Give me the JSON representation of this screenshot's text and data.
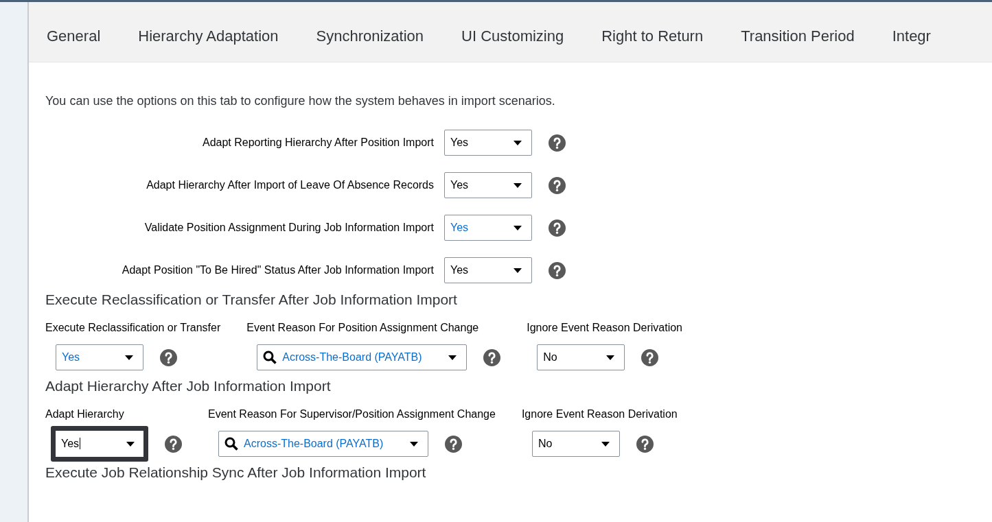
{
  "tabs": [
    {
      "label": "General",
      "selected": false
    },
    {
      "label": "Hierarchy Adaptation",
      "selected": false
    },
    {
      "label": "Synchronization",
      "selected": false
    },
    {
      "label": "UI Customizing",
      "selected": false
    },
    {
      "label": "Right to Return",
      "selected": false
    },
    {
      "label": "Transition Period",
      "selected": false
    },
    {
      "label": "Integr",
      "selected": false
    }
  ],
  "intro": "You can use the options on this tab to configure how the system behaves in import scenarios.",
  "settings": [
    {
      "label": "Adapt Reporting Hierarchy After Position Import",
      "value": "Yes",
      "highlighted": false
    },
    {
      "label": "Adapt Hierarchy After Import of Leave Of Absence Records",
      "value": "Yes",
      "highlighted": false
    },
    {
      "label": "Validate Position Assignment During Job Information Import",
      "value": "Yes",
      "highlighted": true
    },
    {
      "label": "Adapt Position \"To Be Hired\" Status After Job Information Import",
      "value": "Yes",
      "highlighted": false
    }
  ],
  "sections": [
    {
      "title": "Execute Reclassification or Transfer After Job Information Import",
      "fields": [
        {
          "label": "Execute Reclassification or Transfer",
          "kind": "select",
          "value": "Yes",
          "highlighted": true,
          "focused": false
        },
        {
          "label": "Event Reason For Position Assignment Change",
          "kind": "lookup",
          "value": "Across-The-Board (PAYATB)",
          "highlighted": true,
          "focused": false
        },
        {
          "label": "Ignore Event Reason Derivation",
          "kind": "select",
          "value": "No",
          "highlighted": false,
          "focused": false
        }
      ]
    },
    {
      "title": "Adapt Hierarchy After Job Information Import",
      "fields": [
        {
          "label": "Adapt Hierarchy",
          "kind": "select",
          "value": "Yes",
          "highlighted": false,
          "focused": true
        },
        {
          "label": "Event Reason For Supervisor/Position Assignment Change",
          "kind": "lookup",
          "value": "Across-The-Board (PAYATB)",
          "highlighted": true,
          "focused": false
        },
        {
          "label": "Ignore Event Reason Derivation",
          "kind": "select",
          "value": "No",
          "highlighted": false,
          "focused": false
        }
      ]
    },
    {
      "title": "Execute Job Relationship Sync After Job Information Import"
    }
  ]
}
